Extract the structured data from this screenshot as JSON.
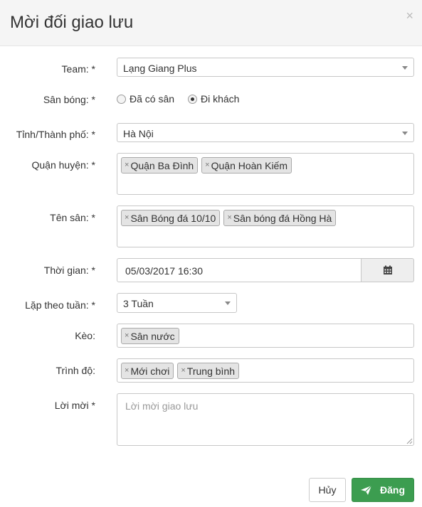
{
  "modal": {
    "title": "Mời đối giao lưu",
    "close_label": "×"
  },
  "form": {
    "team": {
      "label": "Team: *",
      "value": "Lạng Giang Plus"
    },
    "venue": {
      "label": "Sân bóng: *",
      "options": [
        {
          "label": "Đã có sân",
          "checked": false
        },
        {
          "label": "Đi khách",
          "checked": true
        }
      ]
    },
    "province": {
      "label": "Tỉnh/Thành phố: *",
      "value": "Hà Nội"
    },
    "district": {
      "label": "Quận huyện: *",
      "tags": [
        "Quận Ba Đình",
        "Quận Hoàn Kiếm"
      ]
    },
    "field_name": {
      "label": "Tên sân: *",
      "tags": [
        "Sân Bóng đá 10/10",
        "Sân bóng đá Hồng Hà"
      ]
    },
    "time": {
      "label": "Thời gian: *",
      "value": "05/03/2017 16:30"
    },
    "repeat": {
      "label": "Lặp theo tuần: *",
      "value": "3 Tuần"
    },
    "bet": {
      "label": "Kèo:",
      "tags": [
        "Sân nước"
      ]
    },
    "level": {
      "label": "Trình độ:",
      "tags": [
        "Mới chơi",
        "Trung bình"
      ]
    },
    "invitation": {
      "label": "Lời mời *",
      "placeholder": "Lời mời giao lưu"
    }
  },
  "tag_remove_symbol": "×",
  "icons": {
    "calendar": "calendar-icon",
    "send": "paper-plane-icon",
    "close": "close-icon"
  },
  "buttons": {
    "cancel": "Hủy",
    "submit": "Đăng"
  },
  "colors": {
    "primary": "#3c9d50",
    "header_bg": "#f5f5f5"
  }
}
